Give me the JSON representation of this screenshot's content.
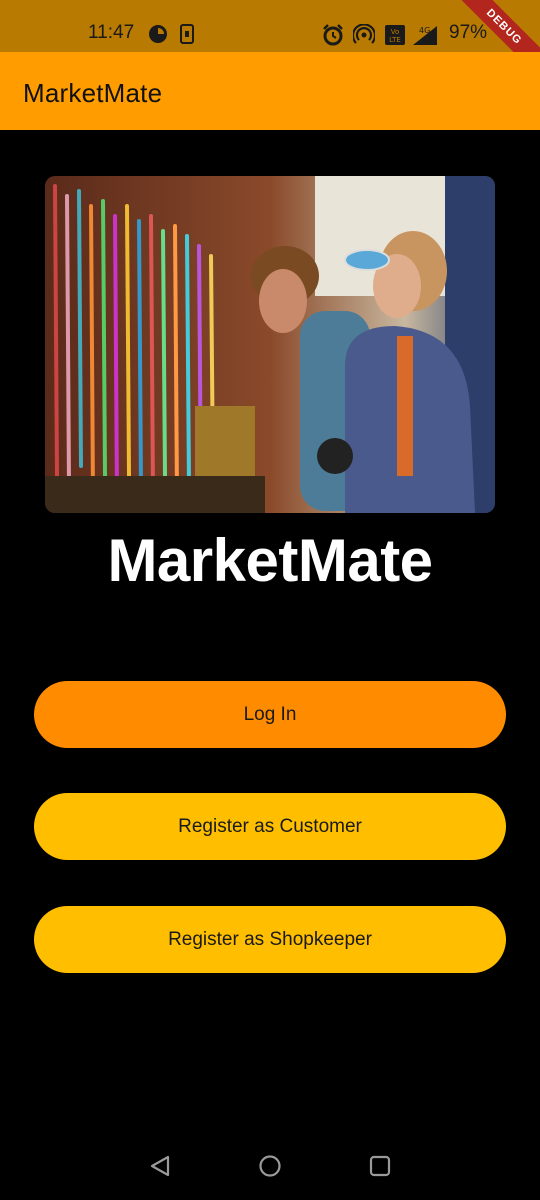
{
  "status_bar": {
    "time": "11:47",
    "battery_percent": "97%",
    "debug_label": "DEBUG",
    "icons": [
      "app-icon",
      "sim-icon",
      "alarm-icon",
      "hotspot-icon",
      "volte-icon",
      "signal-4g-icon"
    ]
  },
  "app_bar": {
    "title": "MarketMate"
  },
  "hero": {
    "title": "MarketMate"
  },
  "buttons": {
    "login": "Log In",
    "register_customer": "Register as Customer",
    "register_shopkeeper": "Register as Shopkeeper"
  },
  "nav_bar": {
    "icons": [
      "back-icon",
      "home-icon",
      "recents-icon"
    ]
  },
  "colors": {
    "app_bar": "#ff9d00",
    "status_bar": "#b87a00",
    "login_button": "#ff8c00",
    "register_button": "#ffbf00",
    "background": "#000000"
  }
}
